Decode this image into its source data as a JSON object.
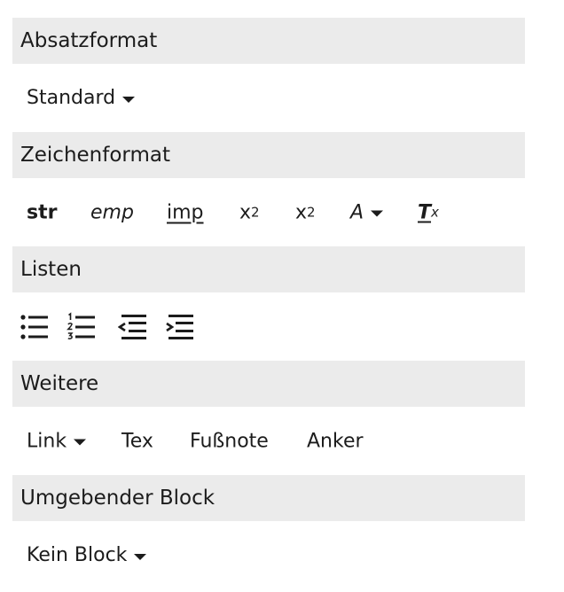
{
  "sections": {
    "absatz": {
      "title": "Absatzformat",
      "dropdown": "Standard"
    },
    "zeichen": {
      "title": "Zeichenformat",
      "strong": "str",
      "emphasis": "emp",
      "important": "imp",
      "sup_base": "x",
      "sup_exp": "2",
      "sub_base": "x",
      "sub_idx": "2",
      "color": "A",
      "clear_T": "T",
      "clear_x": "x"
    },
    "listen": {
      "title": "Listen",
      "icons": [
        "bulleted-list-icon",
        "numbered-list-icon",
        "outdent-icon",
        "indent-icon"
      ]
    },
    "weitere": {
      "title": "Weitere",
      "link": "Link",
      "tex": "Tex",
      "footnote": "Fußnote",
      "anchor": "Anker"
    },
    "block": {
      "title": "Umgebender Block",
      "dropdown": "Kein Block"
    }
  },
  "colors": {
    "header_bg": "#ebebeb",
    "text": "#1c1c1c"
  }
}
